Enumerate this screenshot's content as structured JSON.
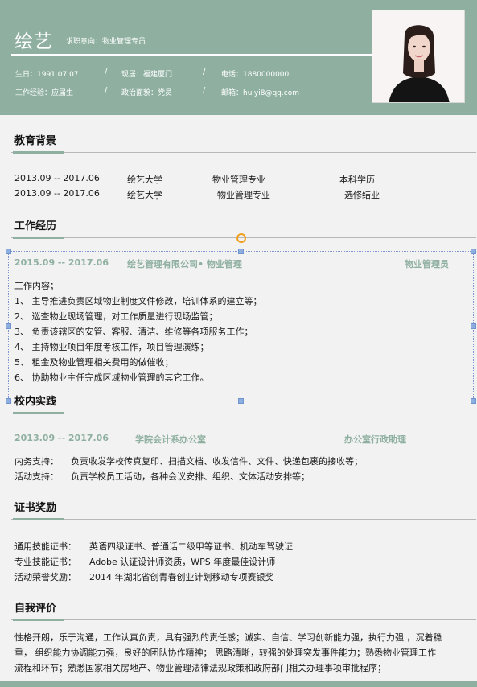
{
  "header": {
    "name": "绘艺",
    "intent": "求职意向：物业管理专员",
    "info_row1": [
      "生日：1991.07.07",
      "现居：福建厦门",
      "电话：1880000000"
    ],
    "info_row2": [
      "工作经验：应届生",
      "政治面貌：党员",
      "邮箱：huiyi8@qq.com"
    ],
    "separator": "/",
    "colors": {
      "accent": "#8fb0a1",
      "background": "#f2f2f2"
    }
  },
  "education": {
    "title": "教育背景",
    "rows": [
      {
        "period": "2013.09 -- 2017.06",
        "school": "绘艺大学",
        "major": "物业管理专业",
        "degree": "本科学历"
      },
      {
        "period": "2013.09 -- 2017.06",
        "school": "绘艺大学",
        "major": "物业管理专业",
        "degree": "选修结业"
      }
    ]
  },
  "work": {
    "title": "工作经历",
    "period": "2015.09 -- 2017.06",
    "company": "绘艺管理有限公司• 物业管理",
    "position": "物业管理员",
    "content_label": "工作内容；",
    "items": [
      "1、 主导推进负责区域物业制度文件修改，培训体系的建立等；",
      "2、 巡查物业现场管理，对工作质量进行现场监管；",
      "3、 负责该辖区的安管、客服、清洁、维修等各项服务工作；",
      "4、 主持物业项目年度考核工作，项目管理演练；",
      "5、 租金及物业管理相关费用的做催收；",
      "6、 协助物业主任完成区域物业管理的其它工作。"
    ]
  },
  "campus": {
    "title": "校内实践",
    "period": "2013.09 -- 2017.06",
    "org": "学院会计系办公室",
    "role": "办公室行政助理",
    "rows": [
      {
        "label": "内务支持：",
        "text": "负责收发学校传真复印、扫描文档、收发信件、文件、快递包裹的接收等；"
      },
      {
        "label": "活动支持：",
        "text": "负责学校员工活动，各种会议安排、组织、文体活动安排等；"
      }
    ]
  },
  "certificates": {
    "title": "证书奖励",
    "rows": [
      {
        "label": "通用技能证书：",
        "text": "英语四级证书、普通话二级甲等证书、机动车驾驶证"
      },
      {
        "label": "专业技能证书：",
        "text": "Adobe 认证设计师资质，WPS 年度最佳设计师"
      },
      {
        "label": "活动荣誉奖励：",
        "text": "2014 年湖北省创青春创业计划移动专项赛银奖"
      }
    ]
  },
  "self_eval": {
    "title": "自我评价",
    "lines": [
      "性格开朗，乐于沟通，工作认真负责，具有强烈的责任感；诚实、自信、学习创新能力强，执行力强 ，沉着稳",
      "重， 组织能力协调能力强，良好的团队协作精神； 思路清晰，较强的处理突发事件能力；熟悉物业管理工作",
      "流程和环节；熟悉国家相关房地产、物业管理法律法规政策和政府部门相关办理事项审批程序；"
    ]
  }
}
